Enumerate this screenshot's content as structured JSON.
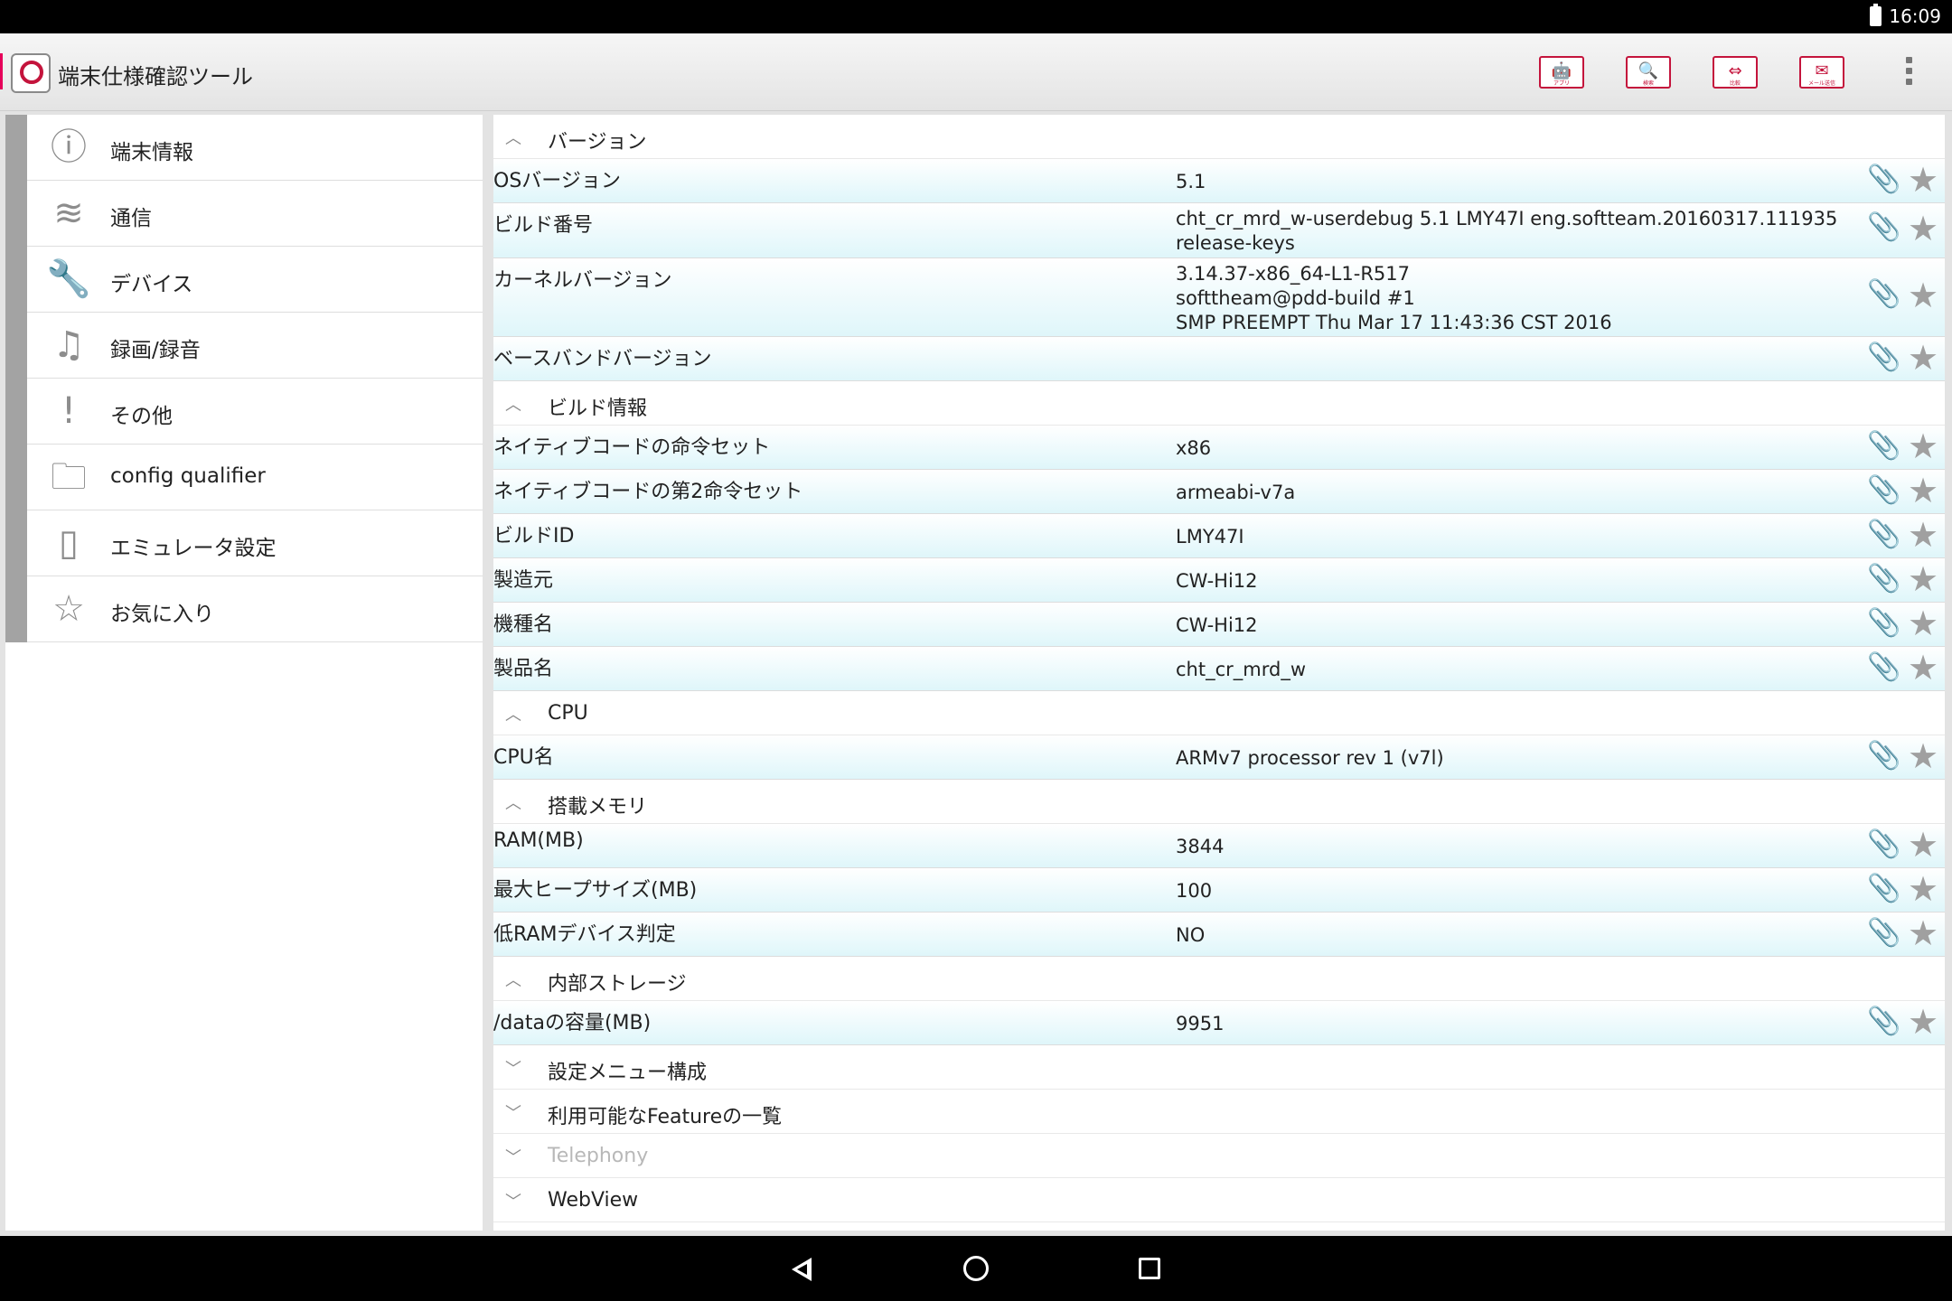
{
  "status_bar": {
    "time": "16:09"
  },
  "app": {
    "title": "端末仕様確認ツール"
  },
  "toolbar": [
    {
      "name": "apps",
      "icon": "android-icon",
      "glyph": "🤖",
      "label": "アプリ"
    },
    {
      "name": "search",
      "icon": "search-icon",
      "glyph": "🔍",
      "label": "検索"
    },
    {
      "name": "compare",
      "icon": "compare-icon",
      "glyph": "⇔",
      "label": "比較"
    },
    {
      "name": "mail",
      "icon": "mail-icon",
      "glyph": "✉",
      "label": "メール送信"
    }
  ],
  "nav": [
    {
      "name": "device-info",
      "label": "端末情報",
      "icon": "info-icon",
      "glyph": "ⓘ"
    },
    {
      "name": "communication",
      "label": "通信",
      "icon": "wifi-icon",
      "glyph": "≋"
    },
    {
      "name": "device",
      "label": "デバイス",
      "icon": "wrench-icon",
      "glyph": "🔧"
    },
    {
      "name": "record",
      "label": "録画/録音",
      "icon": "music-note-icon",
      "glyph": "♫"
    },
    {
      "name": "other",
      "label": "その他",
      "icon": "exclamation-icon",
      "glyph": "!"
    },
    {
      "name": "config-qualifier",
      "label": "config qualifier",
      "icon": "folder-icon",
      "glyph": "🗀"
    },
    {
      "name": "emulator-settings",
      "label": "エミュレータ設定",
      "icon": "tablet-icon",
      "glyph": "▯"
    },
    {
      "name": "favorites",
      "label": "お気に入り",
      "icon": "star-outline-icon",
      "glyph": "☆"
    }
  ],
  "sections": [
    {
      "title": "バージョン",
      "expanded": true,
      "rows": [
        {
          "key": "OSバージョン",
          "value": "5.1",
          "h": 48
        },
        {
          "key": "ビルド番号",
          "value": "cht_cr_mrd_w-userdebug 5.1 LMY47I eng.softteam.20160317.111935 release-keys",
          "h": 60
        },
        {
          "key": "カーネルバージョン",
          "value": "3.14.37-x86_64-L1-R517\nsofttheam@pdd-build #1\nSMP PREEMPT Thu Mar 17 11:43:36 CST 2016",
          "h": 86
        },
        {
          "key": "ベースバンドバージョン",
          "value": "",
          "h": 48
        }
      ]
    },
    {
      "title": "ビルド情報",
      "expanded": true,
      "rows": [
        {
          "key": "ネイティブコードの命令セット",
          "value": "x86",
          "h": 48
        },
        {
          "key": "ネイティブコードの第2命令セット",
          "value": "armeabi-v7a",
          "h": 48
        },
        {
          "key": "ビルドID",
          "value": "LMY47I",
          "h": 48
        },
        {
          "key": "製造元",
          "value": "CW-Hi12",
          "h": 48
        },
        {
          "key": "機種名",
          "value": "CW-Hi12",
          "h": 48
        },
        {
          "key": "製品名",
          "value": "cht_cr_mrd_w",
          "h": 48
        }
      ]
    },
    {
      "title": "CPU",
      "expanded": true,
      "rows": [
        {
          "key": "CPU名",
          "value": "ARMv7 processor rev 1 (v7l)",
          "h": 48
        }
      ]
    },
    {
      "title": "搭載メモリ",
      "expanded": true,
      "rows": [
        {
          "key": "RAM(MB)",
          "value": "3844",
          "h": 48
        },
        {
          "key": "最大ヒープサイズ(MB)",
          "value": "100",
          "h": 48
        },
        {
          "key": "低RAMデバイス判定",
          "value": "NO",
          "h": 48
        }
      ]
    },
    {
      "title": "内部ストレージ",
      "expanded": true,
      "rows": [
        {
          "key": "/dataの容量(MB)",
          "value": "9951",
          "h": 48
        }
      ]
    },
    {
      "title": "設定メニュー構成",
      "expanded": false,
      "rows": []
    },
    {
      "title": "利用可能なFeatureの一覧",
      "expanded": false,
      "rows": []
    },
    {
      "title": "Telephony",
      "expanded": false,
      "disabled": true,
      "rows": []
    },
    {
      "title": "WebView",
      "expanded": false,
      "rows": []
    }
  ],
  "glyphs": {
    "expanded": "︿",
    "collapsed": "﹀",
    "clip": "📎",
    "star": "★"
  },
  "colors": {
    "accent": "#c4143c",
    "row_tint": "#dff6fa",
    "nav_strip": "#a3a3a3"
  }
}
